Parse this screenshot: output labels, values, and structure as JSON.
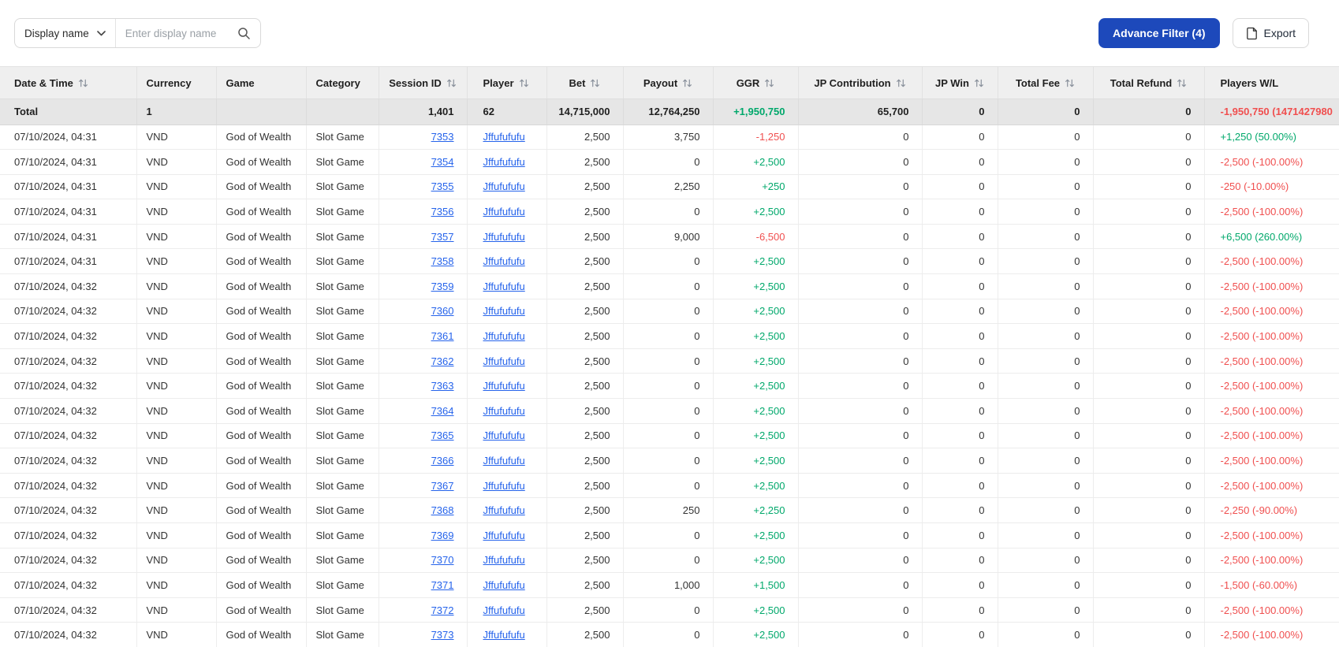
{
  "toolbar": {
    "display_name_dropdown": {
      "label": "Display name"
    },
    "search": {
      "placeholder": "Enter display name"
    },
    "advance_filter_label": "Advance Filter (4)",
    "export_label": "Export"
  },
  "colors": {
    "positive_green": "#00a86b",
    "negative_red": "#f04f4f",
    "link_blue": "#2563eb",
    "primary_button_blue": "#1d49bb"
  },
  "table": {
    "columns": [
      {
        "key": "datetime",
        "label": "Date & Time",
        "sortable": true,
        "align": "left"
      },
      {
        "key": "currency",
        "label": "Currency",
        "sortable": false,
        "align": "left"
      },
      {
        "key": "game",
        "label": "Game",
        "sortable": false,
        "align": "left"
      },
      {
        "key": "category",
        "label": "Category",
        "sortable": false,
        "align": "left"
      },
      {
        "key": "session_id",
        "label": "Session ID",
        "sortable": true,
        "align": "right",
        "header_align": "center"
      },
      {
        "key": "player",
        "label": "Player",
        "sortable": true,
        "align": "left"
      },
      {
        "key": "bet",
        "label": "Bet",
        "sortable": true,
        "align": "right",
        "header_align": "center"
      },
      {
        "key": "payout",
        "label": "Payout",
        "sortable": true,
        "align": "right",
        "header_align": "center"
      },
      {
        "key": "ggr",
        "label": "GGR",
        "sortable": true,
        "align": "right",
        "header_align": "center"
      },
      {
        "key": "jp_contribution",
        "label": "JP Contribution",
        "sortable": true,
        "align": "right",
        "header_align": "center"
      },
      {
        "key": "jp_win",
        "label": "JP Win",
        "sortable": true,
        "align": "right",
        "header_align": "center"
      },
      {
        "key": "total_fee",
        "label": "Total Fee",
        "sortable": true,
        "align": "right",
        "header_align": "center"
      },
      {
        "key": "total_refund",
        "label": "Total Refund",
        "sortable": true,
        "align": "right",
        "header_align": "center"
      },
      {
        "key": "players_wl",
        "label": "Players W/L",
        "sortable": false,
        "align": "left"
      }
    ],
    "total_row": {
      "datetime": "Total",
      "currency": "1",
      "game": "",
      "category": "",
      "session_id": "1,401",
      "player": "62",
      "bet": "14,715,000",
      "payout": "12,764,250",
      "ggr": "+1,950,750",
      "ggr_color": "green",
      "jp_contribution": "65,700",
      "jp_win": "0",
      "total_fee": "0",
      "total_refund": "0",
      "players_wl": "-1,950,750 (1471427980",
      "players_wl_color": "red"
    },
    "row_defaults": {
      "datetime": "07/10/2024, 04:32",
      "currency": "VND",
      "game": "God of Wealth",
      "category": "Slot Game",
      "player": "Jffufufufu",
      "bet": "2,500",
      "payout": "0",
      "ggr": "+2,500",
      "ggr_color": "green",
      "jp_contribution": "0",
      "jp_win": "0",
      "total_fee": "0",
      "total_refund": "0",
      "players_wl": "-2,500 (-100.00%)",
      "players_wl_color": "red"
    },
    "rows": [
      {
        "datetime": "07/10/2024, 04:31",
        "session_id": "7353",
        "payout": "3,750",
        "ggr": "-1,250",
        "ggr_color": "red",
        "players_wl": "+1,250 (50.00%)",
        "players_wl_color": "green"
      },
      {
        "datetime": "07/10/2024, 04:31",
        "session_id": "7354"
      },
      {
        "datetime": "07/10/2024, 04:31",
        "session_id": "7355",
        "payout": "2,250",
        "ggr": "+250",
        "players_wl": "-250 (-10.00%)"
      },
      {
        "datetime": "07/10/2024, 04:31",
        "session_id": "7356"
      },
      {
        "datetime": "07/10/2024, 04:31",
        "session_id": "7357",
        "payout": "9,000",
        "ggr": "-6,500",
        "ggr_color": "red",
        "players_wl": "+6,500 (260.00%)",
        "players_wl_color": "green"
      },
      {
        "datetime": "07/10/2024, 04:31",
        "session_id": "7358"
      },
      {
        "session_id": "7359"
      },
      {
        "session_id": "7360"
      },
      {
        "session_id": "7361"
      },
      {
        "session_id": "7362"
      },
      {
        "session_id": "7363"
      },
      {
        "session_id": "7364"
      },
      {
        "session_id": "7365"
      },
      {
        "session_id": "7366"
      },
      {
        "session_id": "7367"
      },
      {
        "session_id": "7368",
        "payout": "250",
        "ggr": "+2,250",
        "players_wl": "-2,250 (-90.00%)"
      },
      {
        "session_id": "7369"
      },
      {
        "session_id": "7370"
      },
      {
        "session_id": "7371",
        "payout": "1,000",
        "ggr": "+1,500",
        "players_wl": "-1,500 (-60.00%)"
      },
      {
        "session_id": "7372"
      },
      {
        "session_id": "7373"
      }
    ]
  }
}
